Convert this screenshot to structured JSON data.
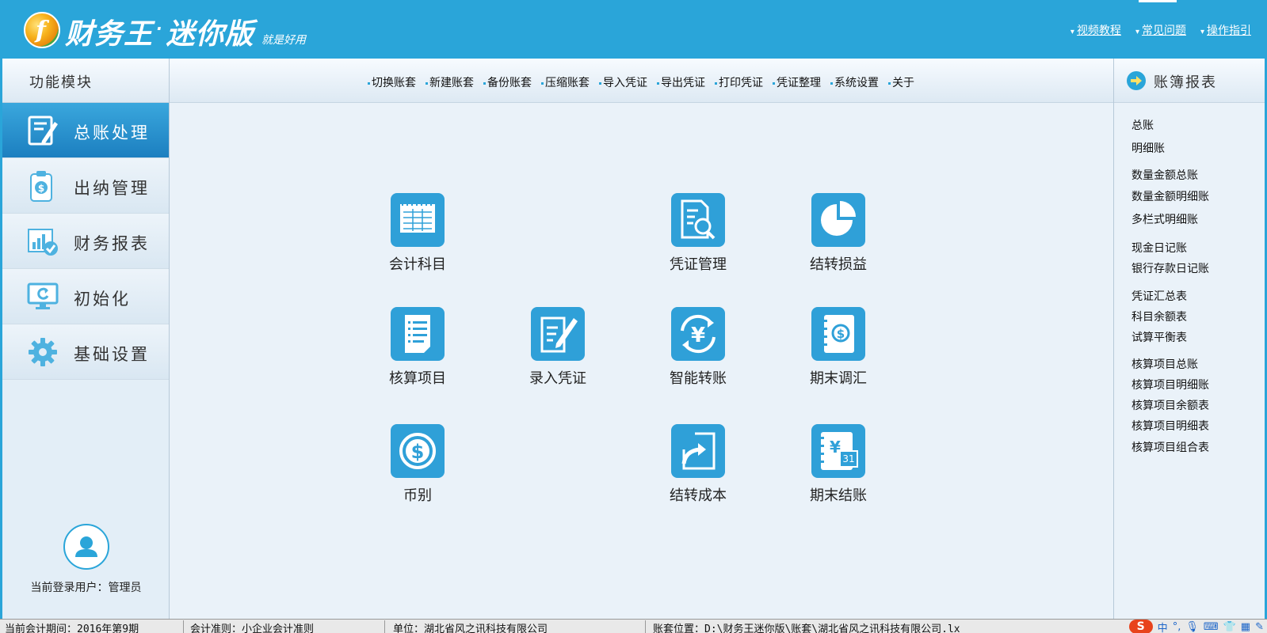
{
  "header": {
    "app_name": "财务王",
    "edition": "迷你版",
    "slogan": "就是好用",
    "links": [
      "视频教程",
      "常见问题",
      "操作指引"
    ]
  },
  "sidebar": {
    "title": "功能模块",
    "items": [
      {
        "label": "总账处理",
        "icon": "edit-document-icon",
        "active": true
      },
      {
        "label": "出纳管理",
        "icon": "cashier-clipboard-icon",
        "active": false
      },
      {
        "label": "财务报表",
        "icon": "report-chart-icon",
        "active": false
      },
      {
        "label": "初始化",
        "icon": "refresh-monitor-icon",
        "active": false
      },
      {
        "label": "基础设置",
        "icon": "gear-icon",
        "active": false
      }
    ],
    "user_label": "当前登录用户：管理员"
  },
  "toolbar": {
    "items": [
      "切换账套",
      "新建账套",
      "备份账套",
      "压缩账套",
      "导入凭证",
      "导出凭证",
      "打印凭证",
      "凭证整理",
      "系统设置",
      "关于"
    ]
  },
  "functions": [
    {
      "label": "会计科目",
      "icon": "ledger-table-icon"
    },
    {
      "label": "凭证管理",
      "icon": "document-search-icon"
    },
    {
      "label": "结转损益",
      "icon": "pie-chart-icon"
    },
    {
      "label": "核算项目",
      "icon": "list-document-icon"
    },
    {
      "label": "录入凭证",
      "icon": "pen-document-icon"
    },
    {
      "label": "智能转账",
      "icon": "yen-cycle-icon"
    },
    {
      "label": "期末调汇",
      "icon": "dollar-book-icon"
    },
    {
      "label": "币别",
      "icon": "dollar-coin-icon"
    },
    {
      "label": "结转成本",
      "icon": "forward-arrow-icon"
    },
    {
      "label": "期末结账",
      "icon": "calendar-yen-icon"
    }
  ],
  "calendar_day": "31",
  "right_panel": {
    "title": "账簿报表",
    "links": [
      "总账",
      "明细账",
      "数量金额总账",
      "数量金额明细账",
      "多栏式明细账",
      "现金日记账",
      "银行存款日记账",
      "凭证汇总表",
      "科目余额表",
      "试算平衡表",
      "核算项目总账",
      "核算项目明细账",
      "核算项目余额表",
      "核算项目明细表",
      "核算项目组合表"
    ]
  },
  "status_bar": {
    "period": "当前会计期间：2016年第9期",
    "standard": "会计准则：小企业会计准则",
    "unit": "单位：湖北省风之讯科技有限公司",
    "path": "账套位置：D:\\财务王迷你版\\账套\\湖北省风之讯科技有限公司.lx"
  },
  "tray": {
    "ime_logo": "S",
    "ime_lang": "中"
  },
  "colors": {
    "brand": "#2aa5d9",
    "icon_bg": "#2fa0d8",
    "active_nav": "#1c7fc0"
  }
}
